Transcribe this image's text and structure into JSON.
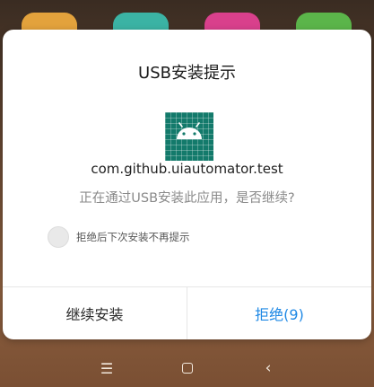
{
  "dialog": {
    "title": "USB安装提示",
    "app_icon": "android-robot-icon",
    "package_name": "com.github.uiautomator.test",
    "message": "正在通过USB安装此应用，是否继续?",
    "checkbox": {
      "label": "拒绝后下次安装不再提示",
      "checked": false
    },
    "buttons": {
      "continue_label": "继续安装",
      "reject_label": "拒绝(9)"
    }
  },
  "navbar": {
    "menu_icon": "menu-icon",
    "home_icon": "home-icon",
    "back_icon": "back-icon"
  },
  "colors": {
    "accent": "#1e88e5",
    "app_icon_bg": "#137a6b",
    "dialog_bg": "#ffffff"
  }
}
